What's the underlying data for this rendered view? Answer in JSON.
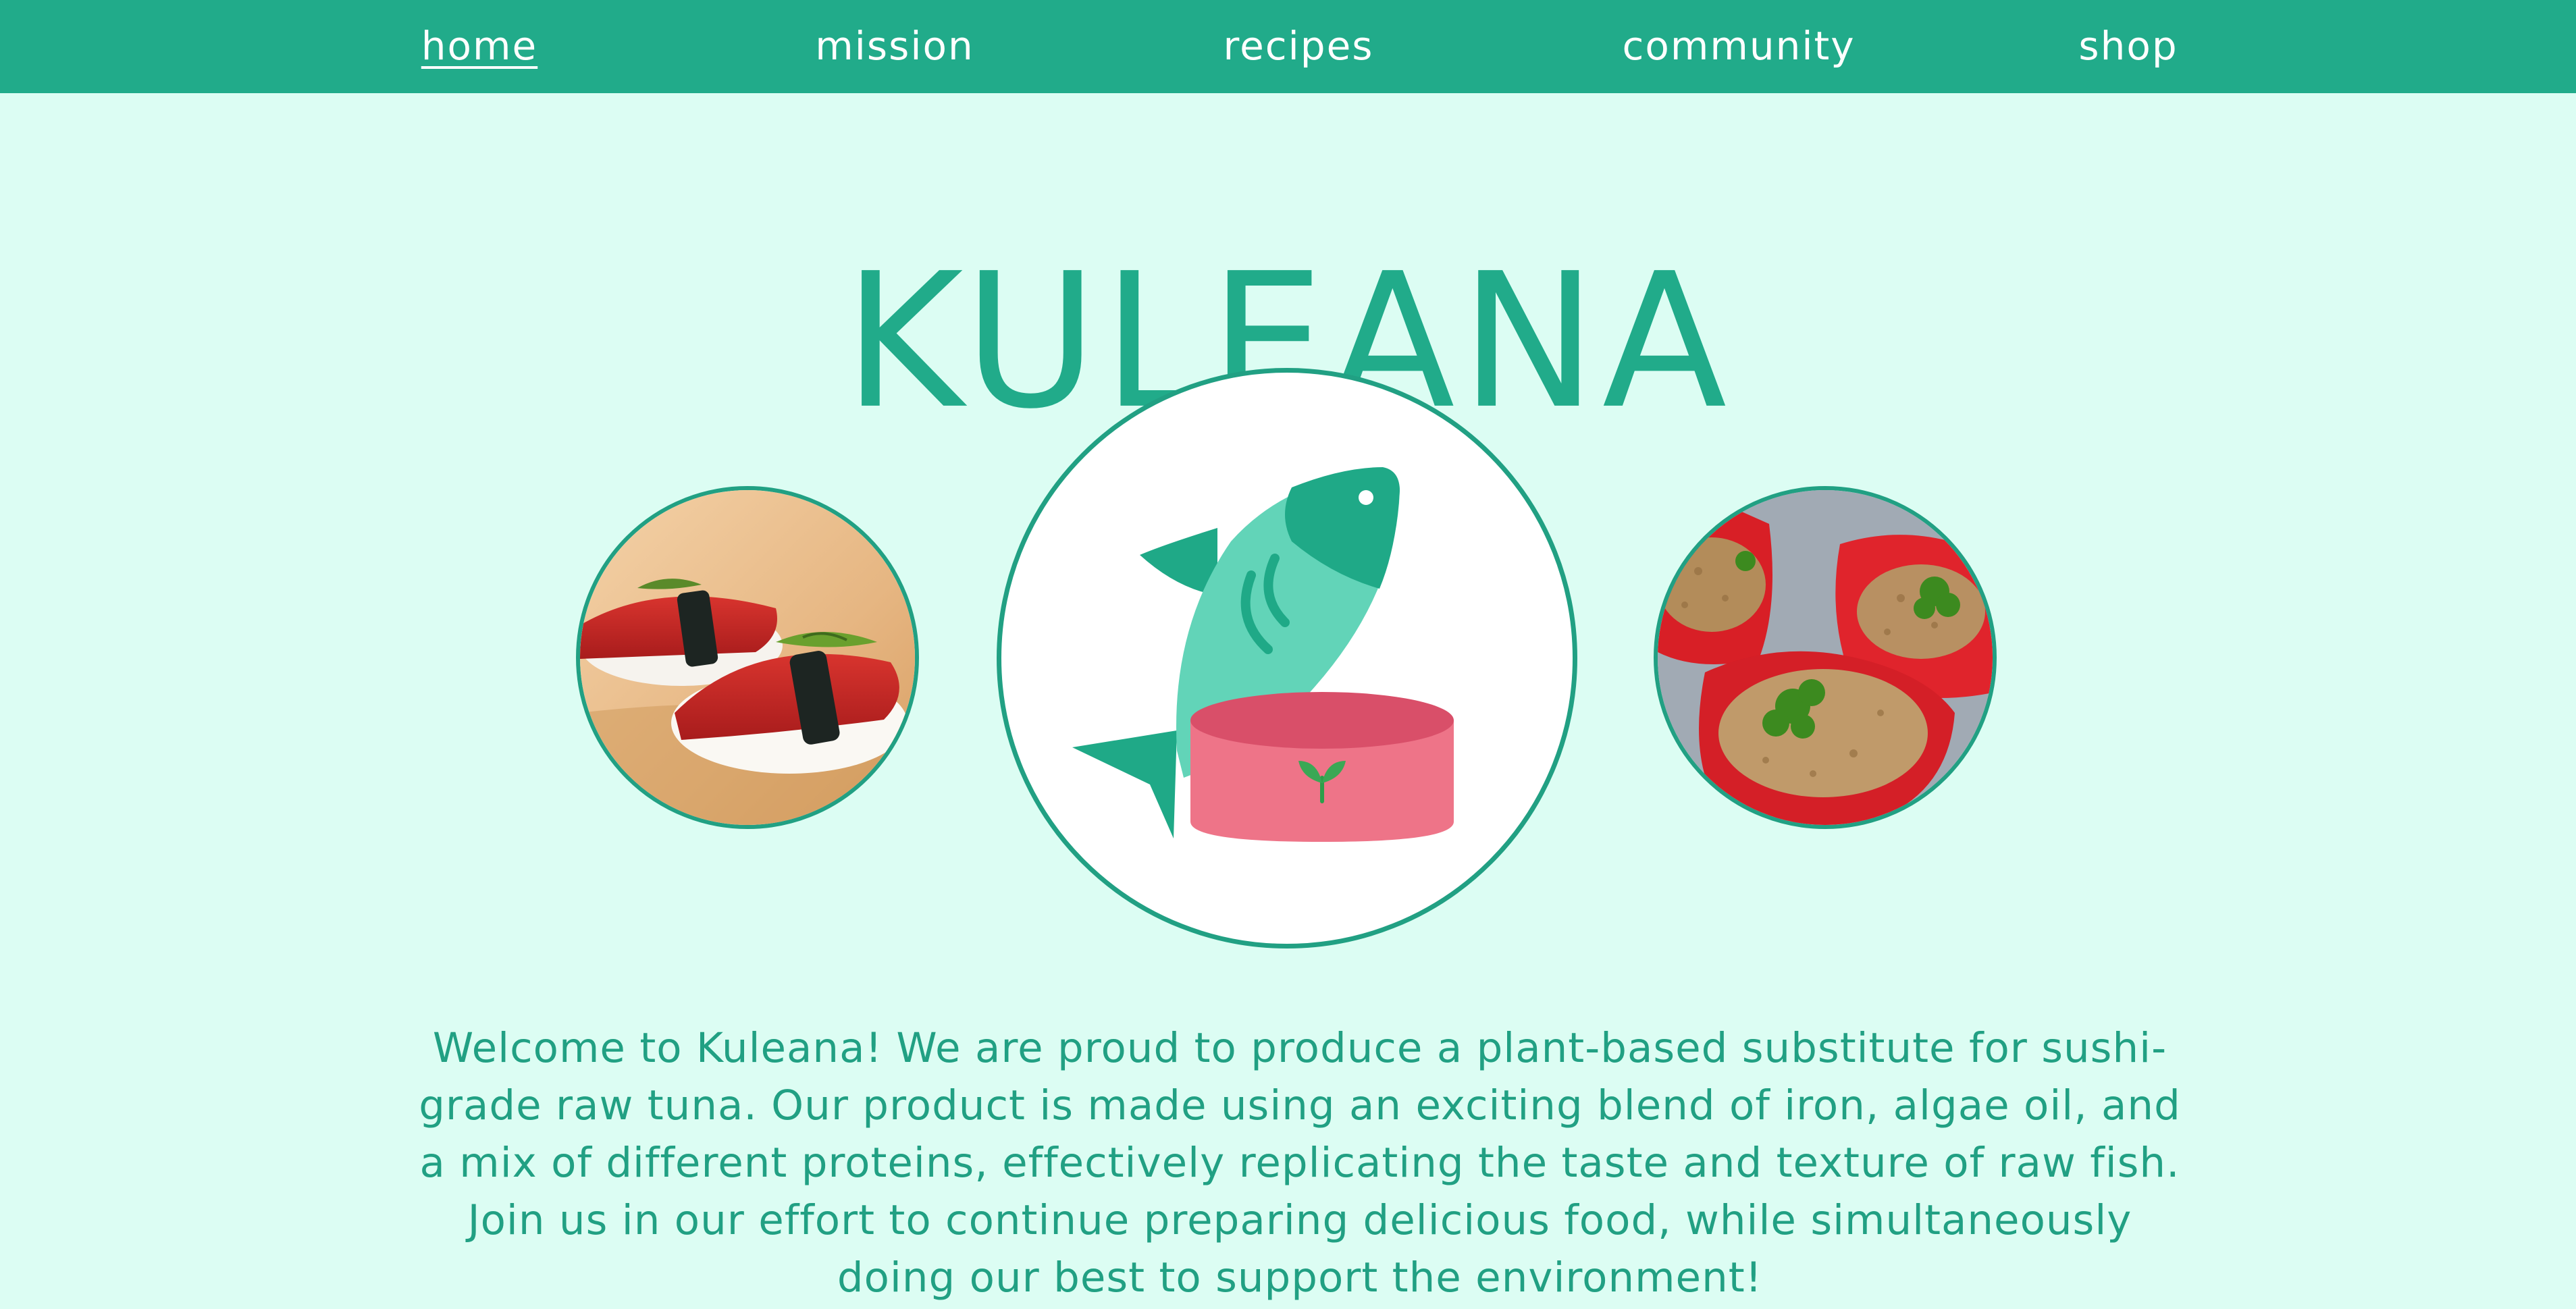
{
  "nav": {
    "items": [
      {
        "label": "home",
        "active": true
      },
      {
        "label": "mission",
        "active": false
      },
      {
        "label": "recipes",
        "active": false
      },
      {
        "label": "community",
        "active": false
      },
      {
        "label": "shop",
        "active": false
      }
    ]
  },
  "brand": {
    "title": "KULEANA"
  },
  "images": {
    "left": {
      "icon": "sushi-nigiri-photo"
    },
    "center": {
      "icon": "fish-in-can-logo-icon"
    },
    "right": {
      "icon": "stuffed-peppers-photo"
    }
  },
  "welcome": {
    "text": "Welcome to Kuleana! We are proud to produce a plant-based substitute for sushi-grade raw tuna. Our product is made using an exciting blend of iron, algae oil, and a mix of different proteins, effectively replicating the taste and texture of raw fish. Join us in our effort to continue preparing delicious food, while simultaneously doing our best to support the environment!"
  },
  "colors": {
    "background": "#dcfdf3",
    "brand": "#21ab8a",
    "border": "#21a083",
    "text": "#21a083",
    "nav_text": "#ffffff"
  }
}
